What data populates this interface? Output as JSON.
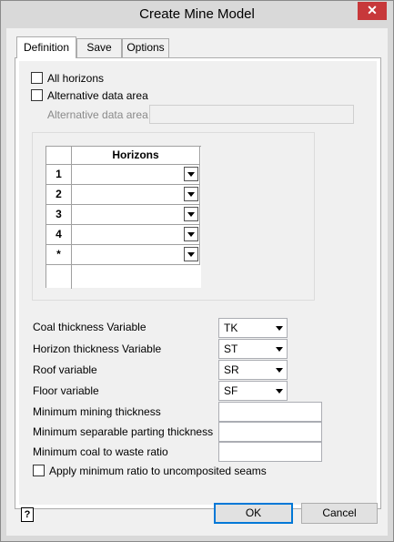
{
  "window": {
    "title": "Create Mine Model",
    "close_glyph": "✕"
  },
  "tabs": [
    "Definition",
    "Save",
    "Options"
  ],
  "definition": {
    "all_horizons_label": "All horizons",
    "alt_data_area_label": "Alternative data area",
    "alt_data_area_field_label": "Alternative data area",
    "alt_data_area_value": ""
  },
  "grid": {
    "column_header": "Horizons",
    "rows": [
      "1",
      "2",
      "3",
      "4",
      "*"
    ]
  },
  "variables": [
    {
      "label": "Coal thickness Variable",
      "value": "TK"
    },
    {
      "label": "Horizon thickness Variable",
      "value": "ST"
    },
    {
      "label": "Roof variable",
      "value": "SR"
    },
    {
      "label": "Floor variable",
      "value": "SF"
    }
  ],
  "thresholds": [
    {
      "label": "Minimum mining thickness",
      "value": ""
    },
    {
      "label": "Minimum separable parting thickness",
      "value": ""
    },
    {
      "label": "Minimum coal to waste ratio",
      "value": ""
    }
  ],
  "apply_ratio_label": "Apply minimum ratio to uncomposited seams",
  "buttons": {
    "ok": "OK",
    "cancel": "Cancel"
  },
  "help_glyph": "?"
}
